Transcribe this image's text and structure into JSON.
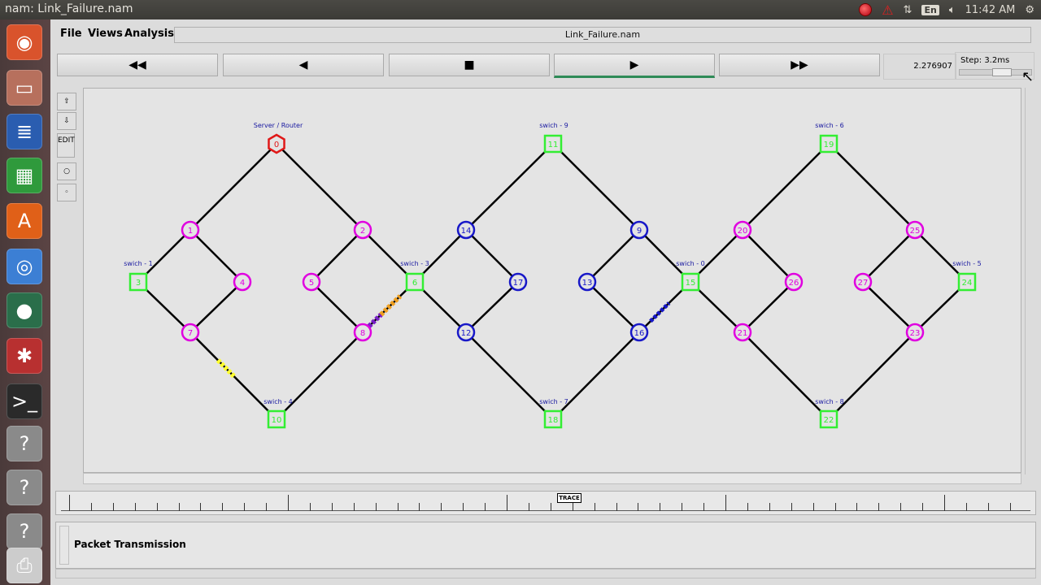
{
  "topbar": {
    "title": "nam: Link_Failure.nam",
    "lang": "En",
    "clock": "11:42 AM"
  },
  "launcher": {
    "items": [
      {
        "name": "ubuntu-dash",
        "glyph": "◉",
        "color": "#d9532c"
      },
      {
        "name": "files",
        "glyph": "▭",
        "color": "#b7705d"
      },
      {
        "name": "writer",
        "glyph": "≣",
        "color": "#2a5db0"
      },
      {
        "name": "calc",
        "glyph": "▦",
        "color": "#2f9a3c"
      },
      {
        "name": "software-center",
        "glyph": "A",
        "color": "#e06018"
      },
      {
        "name": "chromium",
        "glyph": "◎",
        "color": "#3c7fd4"
      },
      {
        "name": "earth",
        "glyph": "●",
        "color": "#2a6e4a"
      },
      {
        "name": "settings",
        "glyph": "✱",
        "color": "#b83030"
      },
      {
        "name": "terminal",
        "glyph": ">_",
        "color": "#2a2a2a"
      },
      {
        "name": "unknown-1",
        "glyph": "?",
        "color": "#8a8a8a"
      },
      {
        "name": "unknown-2",
        "glyph": "?",
        "color": "#8a8a8a"
      },
      {
        "name": "unknown-3",
        "glyph": "?",
        "color": "#8a8a8a"
      },
      {
        "name": "printer",
        "glyph": "⎙",
        "color": "#cccccc"
      }
    ]
  },
  "menu": {
    "file": "File",
    "views": "Views",
    "analysis": "Analysis",
    "filename": "Link_Failure.nam"
  },
  "controls": {
    "rewind": "◀◀",
    "back": "◀",
    "stop": "■",
    "play": "▶",
    "fast_forward": "▶▶",
    "time": "2.276907",
    "step": "Step: 3.2ms"
  },
  "side_buttons": {
    "edit": "EDIT"
  },
  "timeline": {
    "marker": "TRACE"
  },
  "bottom": {
    "label": "Packet Transmission"
  },
  "colors": {
    "magenta": "#e000e0",
    "blue": "#1818c8",
    "green": "#33ee33",
    "red": "#e01818"
  },
  "network": {
    "labels": [
      {
        "text": "Server / Router"
      },
      {
        "text": "swich - 9"
      },
      {
        "text": "swich - 6"
      },
      {
        "text": "swich - 4"
      },
      {
        "text": "swich - 1"
      },
      {
        "text": "swich - 3"
      },
      {
        "text": "swich - 5"
      },
      {
        "text": "swich - 0"
      },
      {
        "text": "swich - 7"
      },
      {
        "text": "swich - 8"
      }
    ],
    "nodes": [
      {
        "id": "0",
        "shape": "hex",
        "color": "red"
      },
      {
        "id": "1",
        "shape": "circle",
        "color": "magenta"
      },
      {
        "id": "2",
        "shape": "circle",
        "color": "magenta"
      },
      {
        "id": "3",
        "shape": "square",
        "color": "green"
      },
      {
        "id": "4",
        "shape": "circle",
        "color": "magenta"
      },
      {
        "id": "5",
        "shape": "circle",
        "color": "magenta"
      },
      {
        "id": "6",
        "shape": "square",
        "color": "green"
      },
      {
        "id": "7",
        "shape": "circle",
        "color": "magenta"
      },
      {
        "id": "8",
        "shape": "circle",
        "color": "magenta"
      },
      {
        "id": "9",
        "shape": "circle",
        "color": "blue"
      },
      {
        "id": "10",
        "shape": "square",
        "color": "green"
      },
      {
        "id": "11",
        "shape": "square",
        "color": "green"
      },
      {
        "id": "12",
        "shape": "circle",
        "color": "blue"
      },
      {
        "id": "13",
        "shape": "circle",
        "color": "blue"
      },
      {
        "id": "14",
        "shape": "circle",
        "color": "blue"
      },
      {
        "id": "15",
        "shape": "square",
        "color": "green"
      },
      {
        "id": "16",
        "shape": "circle",
        "color": "blue"
      },
      {
        "id": "17",
        "shape": "circle",
        "color": "blue"
      },
      {
        "id": "18",
        "shape": "square",
        "color": "green"
      },
      {
        "id": "19",
        "shape": "square",
        "color": "green"
      },
      {
        "id": "20",
        "shape": "circle",
        "color": "magenta"
      },
      {
        "id": "21",
        "shape": "circle",
        "color": "magenta"
      },
      {
        "id": "22",
        "shape": "square",
        "color": "green"
      },
      {
        "id": "23",
        "shape": "circle",
        "color": "magenta"
      },
      {
        "id": "24",
        "shape": "square",
        "color": "green"
      },
      {
        "id": "25",
        "shape": "circle",
        "color": "magenta"
      },
      {
        "id": "26",
        "shape": "circle",
        "color": "magenta"
      },
      {
        "id": "27",
        "shape": "circle",
        "color": "magenta"
      }
    ],
    "links": [
      [
        "0",
        "1"
      ],
      [
        "0",
        "2"
      ],
      [
        "1",
        "3"
      ],
      [
        "1",
        "4"
      ],
      [
        "3",
        "7"
      ],
      [
        "4",
        "7"
      ],
      [
        "7",
        "10"
      ],
      [
        "10",
        "8"
      ],
      [
        "2",
        "5"
      ],
      [
        "2",
        "6"
      ],
      [
        "5",
        "8"
      ],
      [
        "8",
        "6"
      ],
      [
        "6",
        "14"
      ],
      [
        "6",
        "12"
      ],
      [
        "14",
        "11"
      ],
      [
        "14",
        "17"
      ],
      [
        "17",
        "12"
      ],
      [
        "12",
        "18"
      ],
      [
        "11",
        "9"
      ],
      [
        "9",
        "13"
      ],
      [
        "9",
        "15"
      ],
      [
        "13",
        "16"
      ],
      [
        "18",
        "16"
      ],
      [
        "16",
        "15"
      ],
      [
        "15",
        "20"
      ],
      [
        "15",
        "21"
      ],
      [
        "20",
        "19"
      ],
      [
        "20",
        "26"
      ],
      [
        "26",
        "21"
      ],
      [
        "21",
        "22"
      ],
      [
        "19",
        "25"
      ],
      [
        "25",
        "27"
      ],
      [
        "25",
        "24"
      ],
      [
        "27",
        "23"
      ],
      [
        "22",
        "23"
      ],
      [
        "23",
        "24"
      ]
    ],
    "packets": [
      {
        "link": "8-6",
        "color": "orange"
      },
      {
        "link": "8-6",
        "color": "purple"
      },
      {
        "link": "7-10",
        "color": "yellow"
      },
      {
        "link": "16-15",
        "color": "blue"
      }
    ]
  }
}
